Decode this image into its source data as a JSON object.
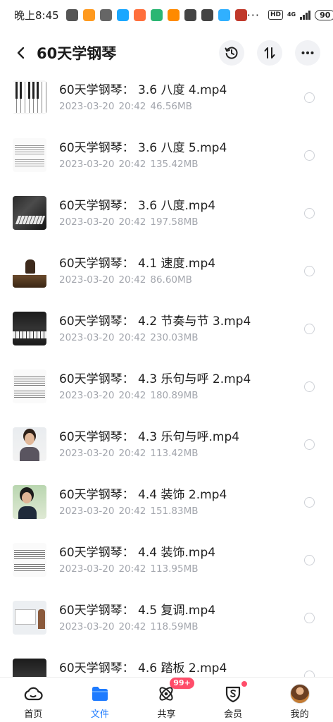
{
  "status_bar": {
    "time": "晚上8:45",
    "more": "···",
    "hd": "HD",
    "network": "4G",
    "battery": "90",
    "app_icon_colors": [
      "#555555",
      "#ff9a1f",
      "#666666",
      "#1aa7ff",
      "#ff6f3c",
      "#2bb673",
      "#ff8a00",
      "#444444",
      "#444444",
      "#30b0ff",
      "#c0392b"
    ]
  },
  "header": {
    "title": "60天学钢琴",
    "back_icon": "chevron-left-icon",
    "actions": [
      "history-icon",
      "sort-icon",
      "more-icon"
    ]
  },
  "files": [
    {
      "name": "60天学钢琴：  3.6 八度 4.mp4",
      "date": "2023-03-20",
      "time": "20:42",
      "size": "46.56MB",
      "thumb": "keys"
    },
    {
      "name": "60天学钢琴：  3.6 八度 5.mp4",
      "date": "2023-03-20",
      "time": "20:42",
      "size": "135.42MB",
      "thumb": "sheet"
    },
    {
      "name": "60天学钢琴：  3.6 八度.mp4",
      "date": "2023-03-20",
      "time": "20:42",
      "size": "197.58MB",
      "thumb": "dark"
    },
    {
      "name": "60天学钢琴：  4.1 速度.mp4",
      "date": "2023-03-20",
      "time": "20:42",
      "size": "86.60MB",
      "thumb": "brownkeys"
    },
    {
      "name": "60天学钢琴：  4.2 节奏与节 3.mp4",
      "date": "2023-03-20",
      "time": "20:42",
      "size": "230.03MB",
      "thumb": "grand"
    },
    {
      "name": "60天学钢琴：  4.3 乐句与呼 2.mp4",
      "date": "2023-03-20",
      "time": "20:42",
      "size": "180.89MB",
      "thumb": "whitesheet"
    },
    {
      "name": "60天学钢琴：  4.3 乐句与呼.mp4",
      "date": "2023-03-20",
      "time": "20:42",
      "size": "113.42MB",
      "thumb": "face"
    },
    {
      "name": "60天学钢琴：  4.4 装饰 2.mp4",
      "date": "2023-03-20",
      "time": "20:42",
      "size": "151.83MB",
      "thumb": "green"
    },
    {
      "name": "60天学钢琴：  4.4 装饰.mp4",
      "date": "2023-03-20",
      "time": "20:42",
      "size": "113.95MB",
      "thumb": "whitesheet"
    },
    {
      "name": "60天学钢琴：  4.5 复调.mp4",
      "date": "2023-03-20",
      "time": "20:42",
      "size": "118.59MB",
      "thumb": "screen"
    },
    {
      "name": "60天学钢琴：  4.6 踏板 2.mp4",
      "date": "2023-03-20",
      "time": "20:42",
      "size": "",
      "thumb": "grand"
    }
  ],
  "tabbar": {
    "tabs": [
      {
        "label": "首页",
        "icon": "cloud-home-icon",
        "active": false
      },
      {
        "label": "文件",
        "icon": "folder-icon",
        "active": true
      },
      {
        "label": "共享",
        "icon": "share-orbit-icon",
        "active": false,
        "badge": "99+"
      },
      {
        "label": "会员",
        "icon": "vip-shield-icon",
        "active": false,
        "dot": true
      },
      {
        "label": "我的",
        "icon": "avatar",
        "active": false
      }
    ]
  },
  "colors": {
    "accent": "#1e7bff",
    "badge": "#ff4d6a",
    "meta_text": "#a3a6ad"
  }
}
